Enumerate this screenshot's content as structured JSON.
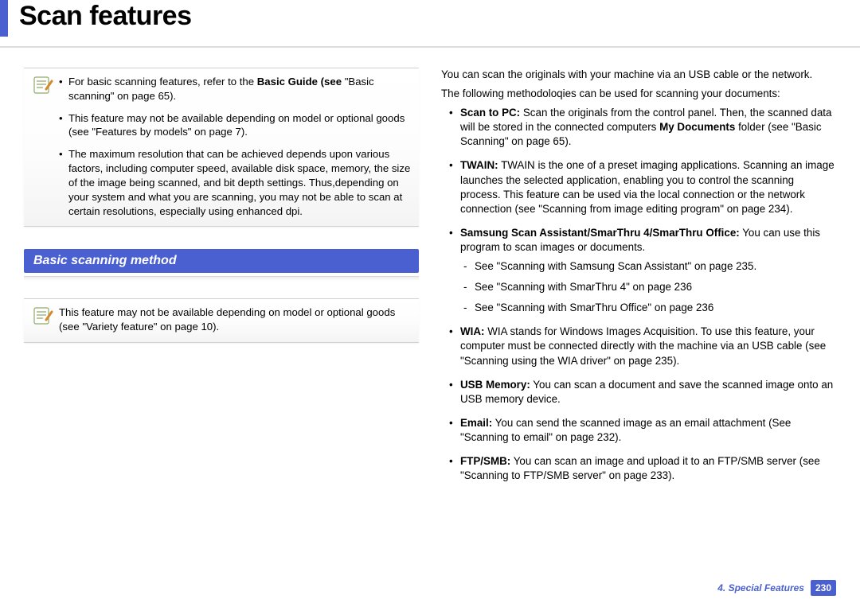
{
  "header": {
    "title": "Scan features"
  },
  "left": {
    "note1": {
      "items": [
        {
          "pre": "For basic scanning features, refer to the ",
          "bold": "Basic Guide (see ",
          "post": "\"Basic scanning\" on page 65)."
        },
        {
          "text": "This feature may not be available depending on model or optional goods (see \"Features by models\" on page 7)."
        },
        {
          "text": "The maximum resolution that can be achieved depends upon various factors, including computer speed, available disk space, memory, the size of the image being scanned, and bit depth settings. Thus,depending on your system and what you are scanning, you may not be able to scan at certain resolutions, especially using enhanced dpi."
        }
      ]
    },
    "section_heading": "Basic scanning method",
    "note2": {
      "text": "This feature may not be available depending on model or optional goods (see \"Variety feature\" on page 10)."
    }
  },
  "right": {
    "intro1": "You can scan the originals with your machine via an USB cable or the network.",
    "intro2": "The following methodoloqies can be used for scanning your documents:",
    "methods": [
      {
        "bold": "Scan to PC:",
        "text_pre": " Scan the originals from the control panel. Then, the scanned data will be stored in the connected computers ",
        "bold2": "My Documents",
        "text_post": " folder (see \"Basic Scanning\" on page 65)."
      },
      {
        "bold": "TWAIN:",
        "text": " TWAIN is the one of a preset imaging applications. Scanning an image launches the selected application, enabling you to control the scanning process. This feature can be used via the local connection or the network connection (see \"Scanning from image editing program\" on page 234)."
      },
      {
        "bold": "Samsung Scan Assistant/SmarThru 4/SmarThru Office:",
        "text": " You can use this program to scan images or documents.",
        "sub": [
          "See \"Scanning with Samsung Scan Assistant\" on page 235.",
          "See \"Scanning with SmarThru 4\" on page 236",
          "See \"Scanning with SmarThru Office\" on page 236"
        ]
      },
      {
        "bold": "WIA:",
        "text": " WIA stands for Windows Images Acquisition. To use this feature, your computer must be connected directly with the machine via an USB cable (see \"Scanning using the WIA driver\" on page 235)."
      },
      {
        "bold": "USB Memory:",
        "text": " You can scan a document and save the scanned image onto an USB memory device."
      },
      {
        "bold": "Email:",
        "text": " You can send the scanned image as an email attachment (See \"Scanning to email\" on page 232)."
      },
      {
        "bold": "FTP/SMB:",
        "text": " You can scan an image and upload it to an FTP/SMB server (see \"Scanning to FTP/SMB server\" on page 233)."
      }
    ]
  },
  "footer": {
    "chapter": "4.  Special Features",
    "page": "230"
  }
}
